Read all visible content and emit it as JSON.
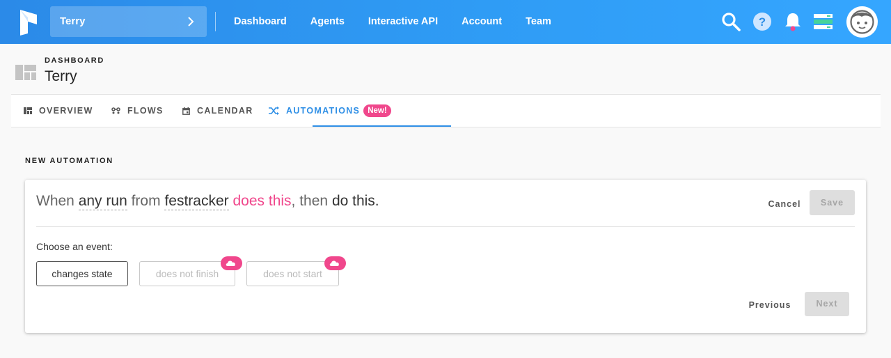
{
  "topbar": {
    "team_name": "Terry",
    "nav": [
      "Dashboard",
      "Agents",
      "Interactive API",
      "Account",
      "Team"
    ],
    "icons": [
      "search-icon",
      "help-icon",
      "bell-icon",
      "server-status-icon",
      "avatar"
    ],
    "colors": {
      "gradient_start": "#2b8ae8",
      "gradient_end": "#35a6ff",
      "notification": "#f0478c",
      "status": "#46d39a"
    }
  },
  "header": {
    "breadcrumb": "DASHBOARD",
    "title": "Terry"
  },
  "tabs": [
    {
      "label": "OVERVIEW",
      "icon": "overview-icon"
    },
    {
      "label": "FLOWS",
      "icon": "flows-icon"
    },
    {
      "label": "CALENDAR",
      "icon": "calendar-icon"
    },
    {
      "label": "AUTOMATIONS",
      "icon": "shuffle-icon",
      "badge": "New!",
      "active": true
    }
  ],
  "section_title": "NEW AUTOMATION",
  "automation": {
    "when": "When",
    "run_scope": "any run",
    "from": "from",
    "flow_name": "festracker",
    "event": "does this",
    "then": ", then",
    "action": "do this.",
    "cancel_label": "Cancel",
    "save_label": "Save"
  },
  "event_picker": {
    "label": "Choose an event:",
    "options": [
      {
        "label": "changes state",
        "selected": true
      },
      {
        "label": "does not finish",
        "cloud_only": true
      },
      {
        "label": "does not start",
        "cloud_only": true
      }
    ],
    "previous_label": "Previous",
    "next_label": "Next"
  },
  "accent_colors": {
    "primary": "#2f8fe6",
    "pink": "#f0478c"
  }
}
